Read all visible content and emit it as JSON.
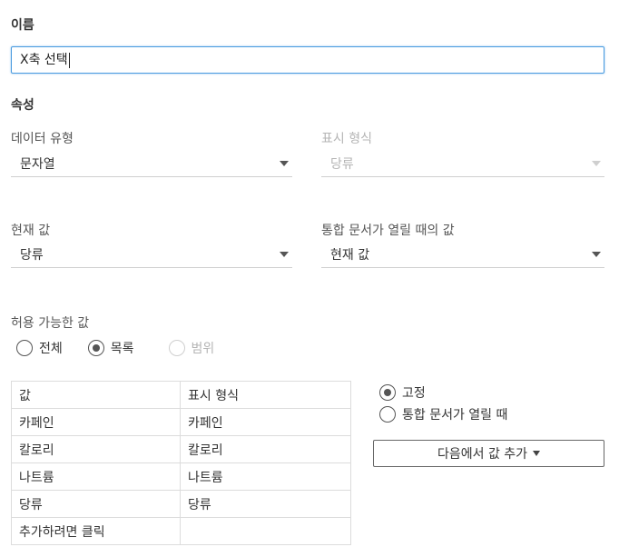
{
  "name_section": {
    "title": "이름",
    "value": "X축 선택"
  },
  "properties": {
    "title": "속성",
    "data_type": {
      "label": "데이터 유형",
      "value": "문자열"
    },
    "display_format": {
      "label": "표시 형식",
      "value": "당류"
    },
    "current_value": {
      "label": "현재 값",
      "value": "당류"
    },
    "open_value": {
      "label": "통합 문서가 열릴 때의 값",
      "value": "현재 값"
    }
  },
  "allowed_values": {
    "label": "허용 가능한 값",
    "options": [
      {
        "label": "전체",
        "checked": false,
        "disabled": false
      },
      {
        "label": "목록",
        "checked": true,
        "disabled": false
      },
      {
        "label": "범위",
        "checked": false,
        "disabled": true
      }
    ]
  },
  "table": {
    "headers": [
      "값",
      "표시 형식"
    ],
    "rows": [
      [
        "카페인",
        "카페인"
      ],
      [
        "칼로리",
        "칼로리"
      ],
      [
        "나트륨",
        "나트륨"
      ],
      [
        "당류",
        "당류"
      ]
    ],
    "add_row_label": "추가하려면 클릭"
  },
  "list_options": {
    "fixed_label": "고정",
    "on_open_label": "통합 문서가 열릴 때",
    "add_from_label": "다음에서 값 추가"
  },
  "colors": {
    "focus": "#4a9be0",
    "disabled": "#b5b5b5",
    "text": "#333333"
  }
}
